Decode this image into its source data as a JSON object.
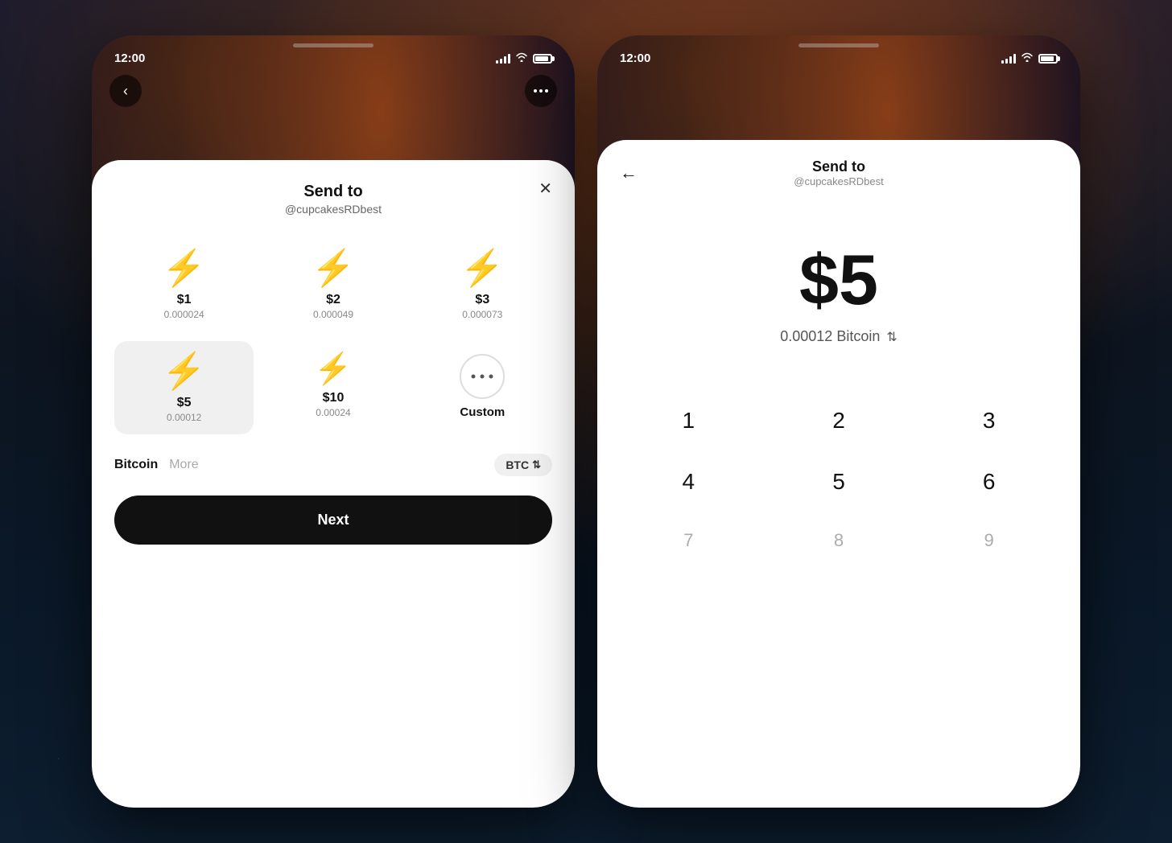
{
  "background": {
    "description": "dark space nebula background"
  },
  "phone1": {
    "status_time": "12:00",
    "header_title": "Send to",
    "header_subtitle": "@cupcakesRDbest",
    "amounts": [
      {
        "usd": "$1",
        "btc": "0.000024",
        "selected": false
      },
      {
        "usd": "$2",
        "btc": "0.000049",
        "selected": false
      },
      {
        "usd": "$3",
        "btc": "0.000073",
        "selected": false
      },
      {
        "usd": "$5",
        "btc": "0.00012",
        "selected": true
      },
      {
        "usd": "$10",
        "btc": "0.00024",
        "selected": false
      }
    ],
    "custom_label": "Custom",
    "currency_tabs": {
      "active": "Bitcoin",
      "inactive": "More"
    },
    "btc_badge": "BTC",
    "next_button": "Next"
  },
  "phone2": {
    "status_time": "12:00",
    "header_title": "Send to",
    "header_subtitle": "@cupcakesRDbest",
    "selected_amount": "$5",
    "btc_equivalent": "0.00012 Bitcoin",
    "numpad": {
      "row1": [
        "1",
        "2",
        "3"
      ],
      "row2": [
        "4",
        "5",
        "6"
      ],
      "row3": [
        "7",
        "8",
        "9"
      ]
    }
  }
}
